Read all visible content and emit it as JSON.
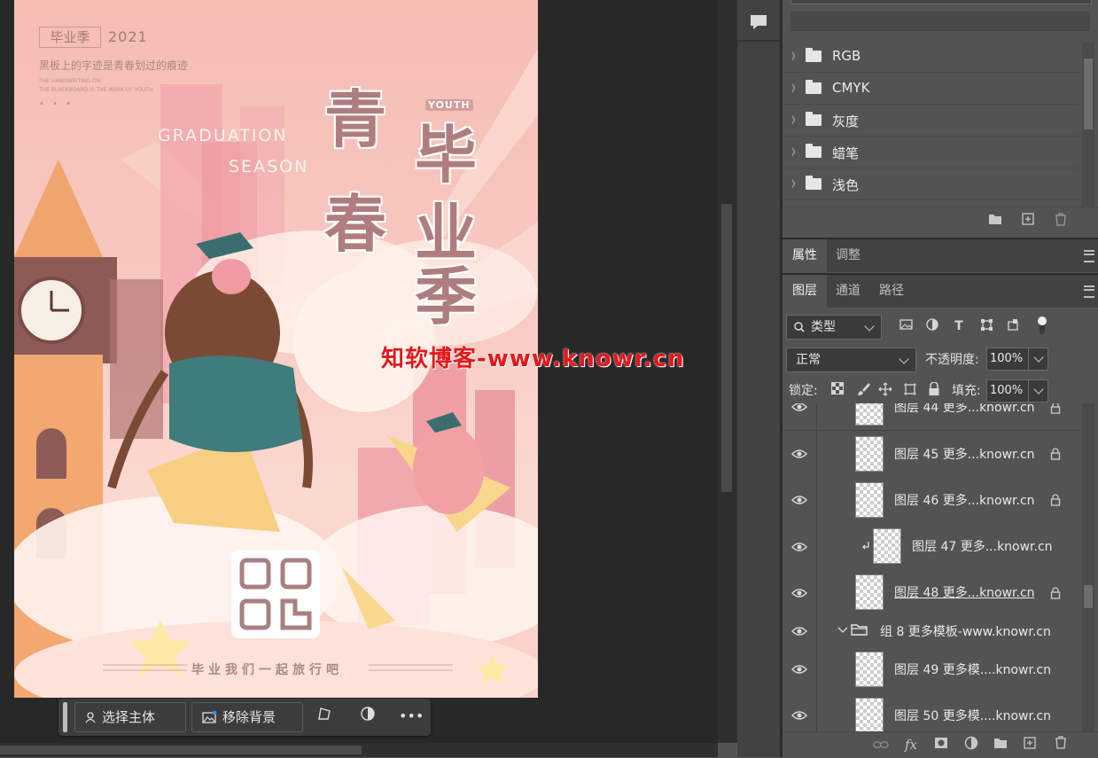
{
  "canvas": {
    "tag": "毕业季",
    "year": "2021",
    "subtitle": "黑板上的字迹是青春划过的痕迹",
    "english_line1": "THE HANDWRITING ON",
    "english_line2": "THE BLACKBOARD IS THE MARK OF YOUTH",
    "dots": "• • •",
    "graduation": "GRADUATION",
    "season": "SEASON",
    "youth": "YOUTH",
    "big_left": [
      "青",
      "春"
    ],
    "big_right": [
      "毕",
      "业",
      "季"
    ],
    "bottom_text": "毕业我们一起旅行吧",
    "watermark": "知软博客-www.knowr.cn"
  },
  "taskbar": {
    "select_subject": "选择主体",
    "remove_bg": "移除背景",
    "more": "•••"
  },
  "swatches": {
    "groups": [
      "RGB",
      "CMYK",
      "灰度",
      "蜡笔",
      "浅色"
    ]
  },
  "properties": {
    "tabs": [
      "属性",
      "调整"
    ]
  },
  "layers_panel": {
    "tabs": [
      "图层",
      "通道",
      "路径"
    ],
    "filter_label": "类型",
    "blend_mode": "正常",
    "opacity_label": "不透明度:",
    "opacity_value": "100%",
    "lock_label": "锁定:",
    "fill_label": "填充:",
    "fill_value": "100%",
    "layers": [
      {
        "name": "图层 44  更多...knowr.cn"
      },
      {
        "name": "图层 45  更多...knowr.cn"
      },
      {
        "name": "图层 46  更多...knowr.cn"
      },
      {
        "name": "图层 47  更多...knowr.cn"
      },
      {
        "name": "图层 48  更多...knowr.cn"
      },
      {
        "name": "组 8  更多模板-www.knowr.cn"
      },
      {
        "name": "图层 49  更多模....knowr.cn"
      },
      {
        "name": "图层 50  更多模....knowr.cn"
      }
    ]
  },
  "colors": {
    "accent_watermark": "#e8161a",
    "panel_bg": "#535353",
    "poster_pink": "#f6bdb3"
  }
}
